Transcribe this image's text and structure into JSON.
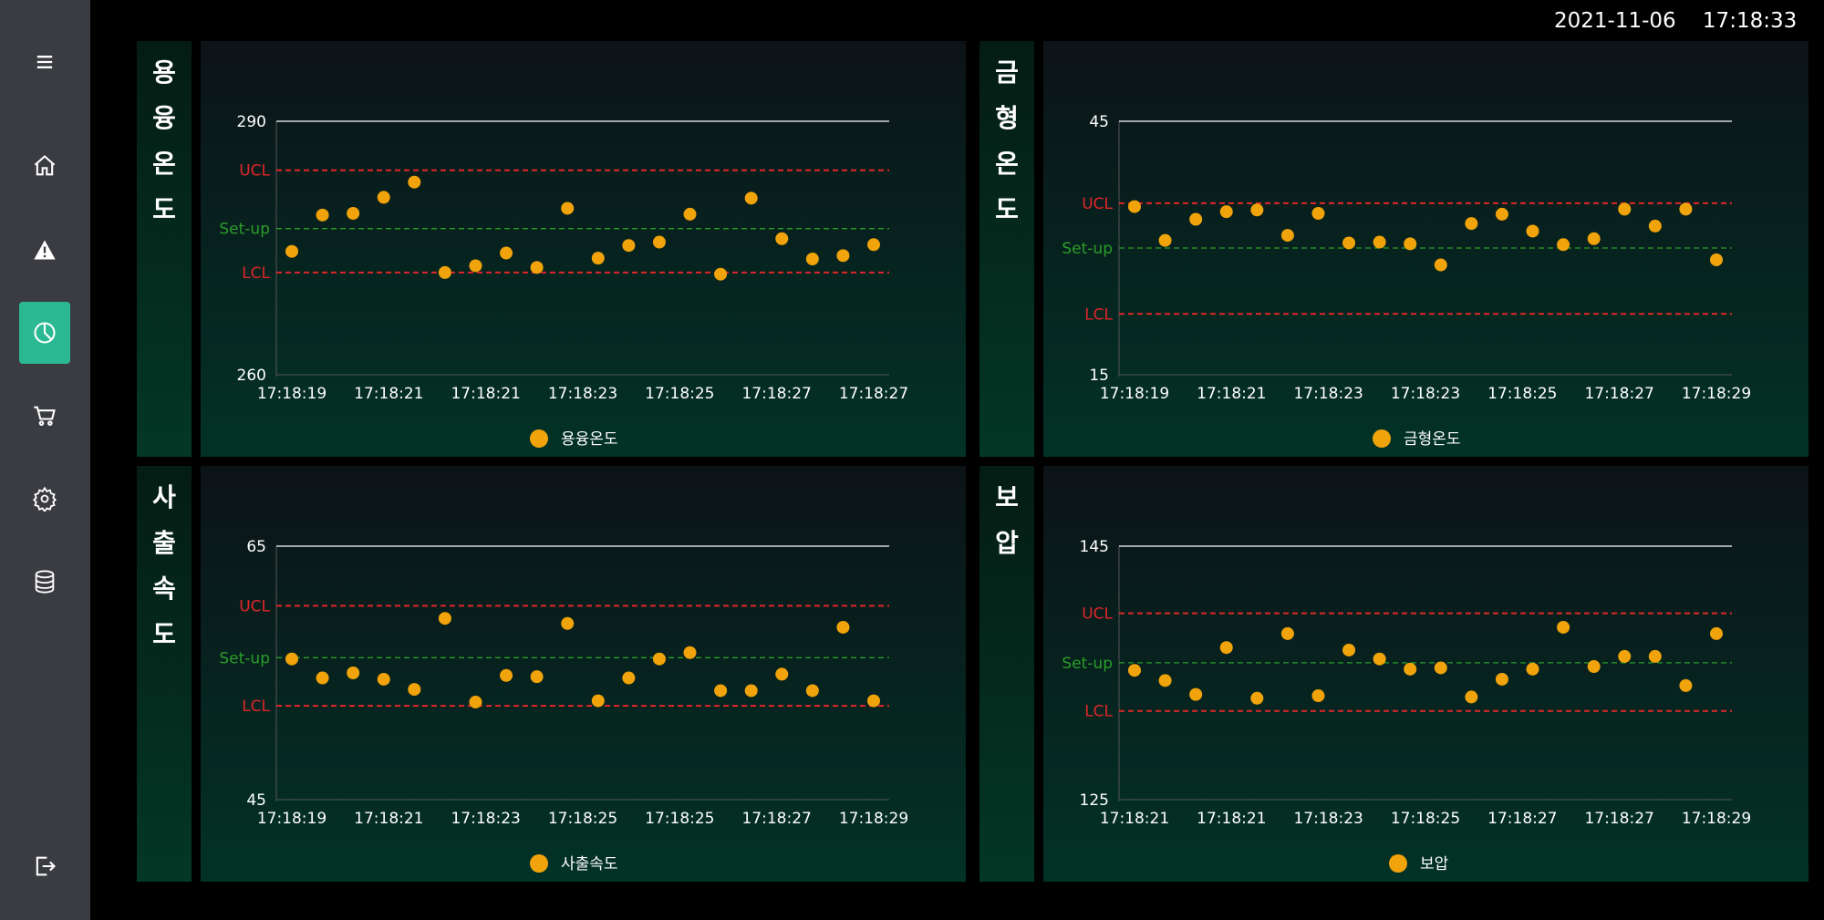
{
  "datetime": {
    "date": "2021-11-06",
    "time": "17:18:33"
  },
  "sidebar": {
    "items": [
      {
        "name": "menu-icon",
        "active": false
      },
      {
        "name": "home-icon",
        "active": false
      },
      {
        "name": "warning-icon",
        "active": false
      },
      {
        "name": "chart-pie-icon",
        "active": true
      },
      {
        "name": "cart-icon",
        "active": false
      },
      {
        "name": "settings-gear-icon",
        "active": false
      },
      {
        "name": "database-icon",
        "active": false
      },
      {
        "name": "logout-icon",
        "active": false
      }
    ]
  },
  "colors": {
    "marker": "#f0a30a",
    "ucl": "#e0262a",
    "setup": "#2a9d2a",
    "top": "#ffffff",
    "accent": "#2bb994"
  },
  "panels": [
    {
      "label_chars": [
        "용",
        "융",
        "온",
        "도"
      ]
    },
    {
      "label_chars": [
        "금",
        "형",
        "온",
        "도"
      ]
    },
    {
      "label_chars": [
        "사",
        "출",
        "속",
        "도"
      ]
    },
    {
      "label_chars": [
        "보",
        "압"
      ]
    }
  ],
  "chart_data": [
    {
      "type": "scatter",
      "title": "용융온도",
      "series": [
        {
          "name": "용융온도",
          "values": [
            274.6,
            278.9,
            279.1,
            281.0,
            282.8,
            272.1,
            272.9,
            274.4,
            272.7,
            279.7,
            273.8,
            275.3,
            275.7,
            279.0,
            271.9,
            280.9,
            276.1,
            273.7,
            274.1,
            275.4
          ]
        }
      ],
      "ylim": [
        260,
        290
      ],
      "top_line": 290,
      "control_lines": {
        "ucl": 284.2,
        "setup": 277.3,
        "lcl": 272.1
      },
      "line_labels": {
        "ucl": "UCL",
        "setup": "Set-up",
        "lcl": "LCL"
      },
      "yticks": [
        "290",
        "260"
      ],
      "xticks": [
        "17:18:19",
        "17:18:21",
        "17:18:21",
        "17:18:23",
        "17:18:25",
        "17:18:27",
        "17:18:27"
      ]
    },
    {
      "type": "scatter",
      "title": "금형온도",
      "series": [
        {
          "name": "금형온도",
          "values": [
            34.9,
            30.9,
            33.4,
            34.3,
            34.5,
            31.5,
            34.1,
            30.6,
            30.7,
            30.5,
            28.0,
            32.9,
            34.0,
            32.0,
            30.4,
            31.1,
            34.6,
            32.6,
            34.6,
            28.6
          ]
        }
      ],
      "ylim": [
        15,
        45
      ],
      "top_line": 45,
      "control_lines": {
        "ucl": 35.3,
        "setup": 30.0,
        "lcl": 22.2
      },
      "line_labels": {
        "ucl": "UCL",
        "setup": "Set-up",
        "lcl": "LCL"
      },
      "yticks": [
        "45",
        "15"
      ],
      "xticks": [
        "17:18:19",
        "17:18:21",
        "17:18:23",
        "17:18:23",
        "17:18:25",
        "17:18:27",
        "17:18:29"
      ]
    },
    {
      "type": "scatter",
      "title": "사출속도",
      "series": [
        {
          "name": "사출속도",
          "values": [
            56.1,
            54.6,
            55.0,
            54.5,
            53.7,
            59.3,
            52.7,
            54.8,
            54.7,
            58.9,
            52.8,
            54.6,
            56.1,
            56.6,
            53.6,
            53.6,
            54.9,
            53.6,
            58.6,
            52.8
          ]
        }
      ],
      "ylim": [
        45,
        65
      ],
      "top_line": 65,
      "control_lines": {
        "ucl": 60.3,
        "setup": 56.2,
        "lcl": 52.4
      },
      "line_labels": {
        "ucl": "UCL",
        "setup": "Set-up",
        "lcl": "LCL"
      },
      "yticks": [
        "65",
        "45"
      ],
      "xticks": [
        "17:18:19",
        "17:18:21",
        "17:18:23",
        "17:18:25",
        "17:18:25",
        "17:18:27",
        "17:18:29"
      ]
    },
    {
      "type": "scatter",
      "title": "보압",
      "series": [
        {
          "name": "보압",
          "values": [
            135.2,
            134.4,
            133.3,
            137.0,
            133.0,
            138.1,
            133.2,
            136.8,
            136.1,
            135.3,
            135.4,
            133.1,
            134.5,
            135.3,
            138.6,
            135.5,
            136.3,
            136.3,
            134.0,
            138.1
          ]
        }
      ],
      "ylim": [
        125,
        145
      ],
      "top_line": 145,
      "control_lines": {
        "ucl": 139.7,
        "setup": 135.8,
        "lcl": 132.0
      },
      "line_labels": {
        "ucl": "UCL",
        "setup": "Set-up",
        "lcl": "LCL"
      },
      "yticks": [
        "145",
        "125"
      ],
      "xticks": [
        "17:18:21",
        "17:18:21",
        "17:18:23",
        "17:18:25",
        "17:18:27",
        "17:18:27",
        "17:18:29"
      ]
    }
  ]
}
